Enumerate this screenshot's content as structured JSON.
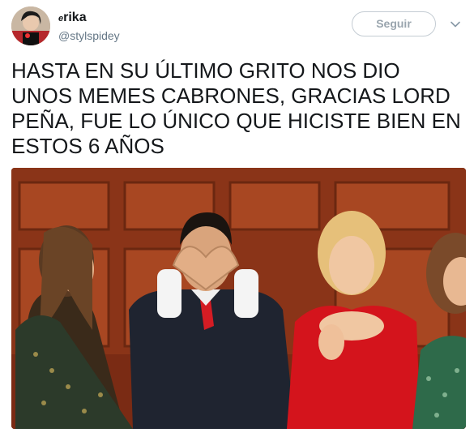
{
  "tweet": {
    "author": {
      "display_name_prefix": "e",
      "display_name": "rika",
      "handle": "@stylspidey",
      "avatar_icon": "user-avatar"
    },
    "follow_button_label": "Seguir",
    "menu_icon": "chevron-down-icon",
    "text": "HASTA EN SU ÚLTIMO GRITO NOS DIO UNOS MEMES CABRONES, GRACIAS LORD PEÑA, FUE LO ÚNICO QUE HICISTE BIEN EN ESTOS 6 AÑOS",
    "media": {
      "kind": "photo"
    }
  },
  "colors": {
    "text": "#14171a",
    "secondary_text": "#657786",
    "button_border": "#c4ccd3",
    "button_text": "#9aa5ae",
    "photo_background": "#8a3418",
    "red_dress": "#d4141c"
  }
}
